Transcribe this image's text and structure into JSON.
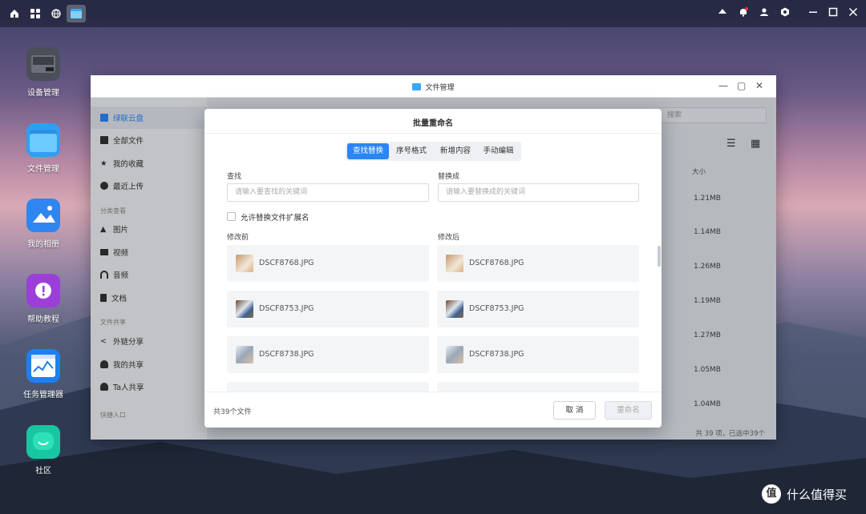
{
  "topbar": {
    "left_icons": [
      "home-icon",
      "apps-grid-icon",
      "globe-icon",
      "file-manager-app-icon"
    ],
    "right_icons": [
      "triangle-up-icon",
      "bell-icon",
      "user-icon",
      "settings-icon",
      "minimize-icon",
      "maximize-icon",
      "close-icon"
    ]
  },
  "desktop": {
    "icons": [
      {
        "label": "设备管理",
        "icon": "device-icon",
        "color": "#4a4f59"
      },
      {
        "label": "文件管理",
        "icon": "folder-icon",
        "color": "#2f9ff2"
      },
      {
        "label": "我的相册",
        "icon": "photo-icon",
        "color": "#2f86f0"
      },
      {
        "label": "帮助教程",
        "icon": "help-icon",
        "color": "#9b3fd8"
      },
      {
        "label": "任务管理器",
        "icon": "task-chart-icon",
        "color": "#1f7ff0"
      },
      {
        "label": "社区",
        "icon": "community-icon",
        "color": "#19c6a2"
      }
    ]
  },
  "window": {
    "title": "文件管理",
    "search_placeholder": "搜索",
    "sidebar": {
      "items": [
        {
          "label": "绿联云盘",
          "icon": "cloud-drive-icon",
          "active": true
        },
        {
          "label": "全部文件",
          "icon": "file-icon"
        },
        {
          "label": "我的收藏",
          "icon": "star-icon"
        },
        {
          "label": "最近上传",
          "icon": "clock-icon"
        }
      ],
      "section_category": "分类查看",
      "category_items": [
        {
          "label": "图片",
          "icon": "image-icon"
        },
        {
          "label": "视频",
          "icon": "video-icon"
        },
        {
          "label": "音频",
          "icon": "headphones-icon"
        },
        {
          "label": "文档",
          "icon": "document-icon"
        }
      ],
      "section_share": "文件共享",
      "share_items": [
        {
          "label": "外链分享",
          "icon": "share-icon"
        },
        {
          "label": "我的共享",
          "icon": "users-icon"
        },
        {
          "label": "Ta人共享",
          "icon": "users-icon"
        }
      ],
      "section_quick": "快捷入口"
    },
    "size_header": "大小",
    "sizes": [
      "1.21MB",
      "1.14MB",
      "1.26MB",
      "1.19MB",
      "1.27MB",
      "1.05MB",
      "1.04MB"
    ],
    "footer": "共 39 项，已选中39个"
  },
  "modal": {
    "title": "批量重命名",
    "tabs": [
      "查找替换",
      "序号格式",
      "新增内容",
      "手动编辑"
    ],
    "active_tab": 0,
    "find_label": "查找",
    "find_placeholder": "请输入要查找的关键词",
    "replace_label": "替换成",
    "replace_placeholder": "请输入要替换成的关键词",
    "allow_ext_label": "允许替换文件扩展名",
    "before_label": "修改前",
    "after_label": "修改后",
    "files": [
      {
        "before": "DSCF8768.JPG",
        "after": "DSCF8768.JPG"
      },
      {
        "before": "DSCF8753.JPG",
        "after": "DSCF8753.JPG"
      },
      {
        "before": "DSCF8738.JPG",
        "after": "DSCF8738.JPG"
      }
    ],
    "count": "共39个文件",
    "cancel": "取 消",
    "rename": "重命名"
  },
  "watermark": {
    "symbol": "值",
    "text": "什么值得买"
  }
}
